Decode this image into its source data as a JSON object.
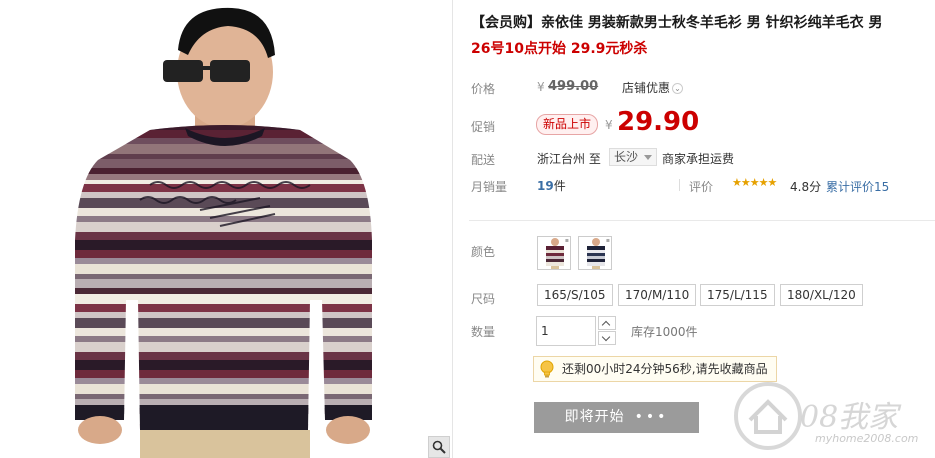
{
  "product": {
    "title": "【会员购】亲依佳 男装新款男士秋冬羊毛衫 男 针织衫纯羊毛衣 男",
    "subtitle": "26号10点开始 29.9元秒杀"
  },
  "price": {
    "label": "价格",
    "currency": "¥",
    "original": "499.00",
    "shop_promo": "店铺优惠",
    "shop_promo_icon": "chevron-down-icon"
  },
  "promo": {
    "label": "促销",
    "badge": "新品上市",
    "currency": "¥",
    "price": "29.90"
  },
  "shipping": {
    "label": "配送",
    "from": "浙江台州  至",
    "to": "长沙",
    "fee": "商家承担运费"
  },
  "sales": {
    "label": "月销量",
    "count": "19",
    "unit": "件",
    "review_label": "评价",
    "stars": "★★★★★",
    "score": "4.8分",
    "review_total": "累计评价15"
  },
  "color": {
    "label": "颜色",
    "options": [
      "wine-stripe",
      "navy-stripe"
    ]
  },
  "size": {
    "label": "尺码",
    "options": [
      "165/S/105",
      "170/M/110",
      "175/L/115",
      "180/XL/120"
    ]
  },
  "quantity": {
    "label": "数量",
    "value": "1",
    "stock": "库存1000件"
  },
  "notice": {
    "icon": "lightbulb-icon",
    "text": "还剩00小时24分钟56秒,请先收藏商品"
  },
  "action": {
    "start_label": "即将开始",
    "dots": "•••"
  },
  "watermark": {
    "text": "08我家",
    "url": "myhome2008.com"
  },
  "colors": {
    "accent_red": "#cc0000",
    "link_blue": "#3a6ea5",
    "button_gray": "#9b9b9b",
    "star_gold": "#e6a100"
  }
}
